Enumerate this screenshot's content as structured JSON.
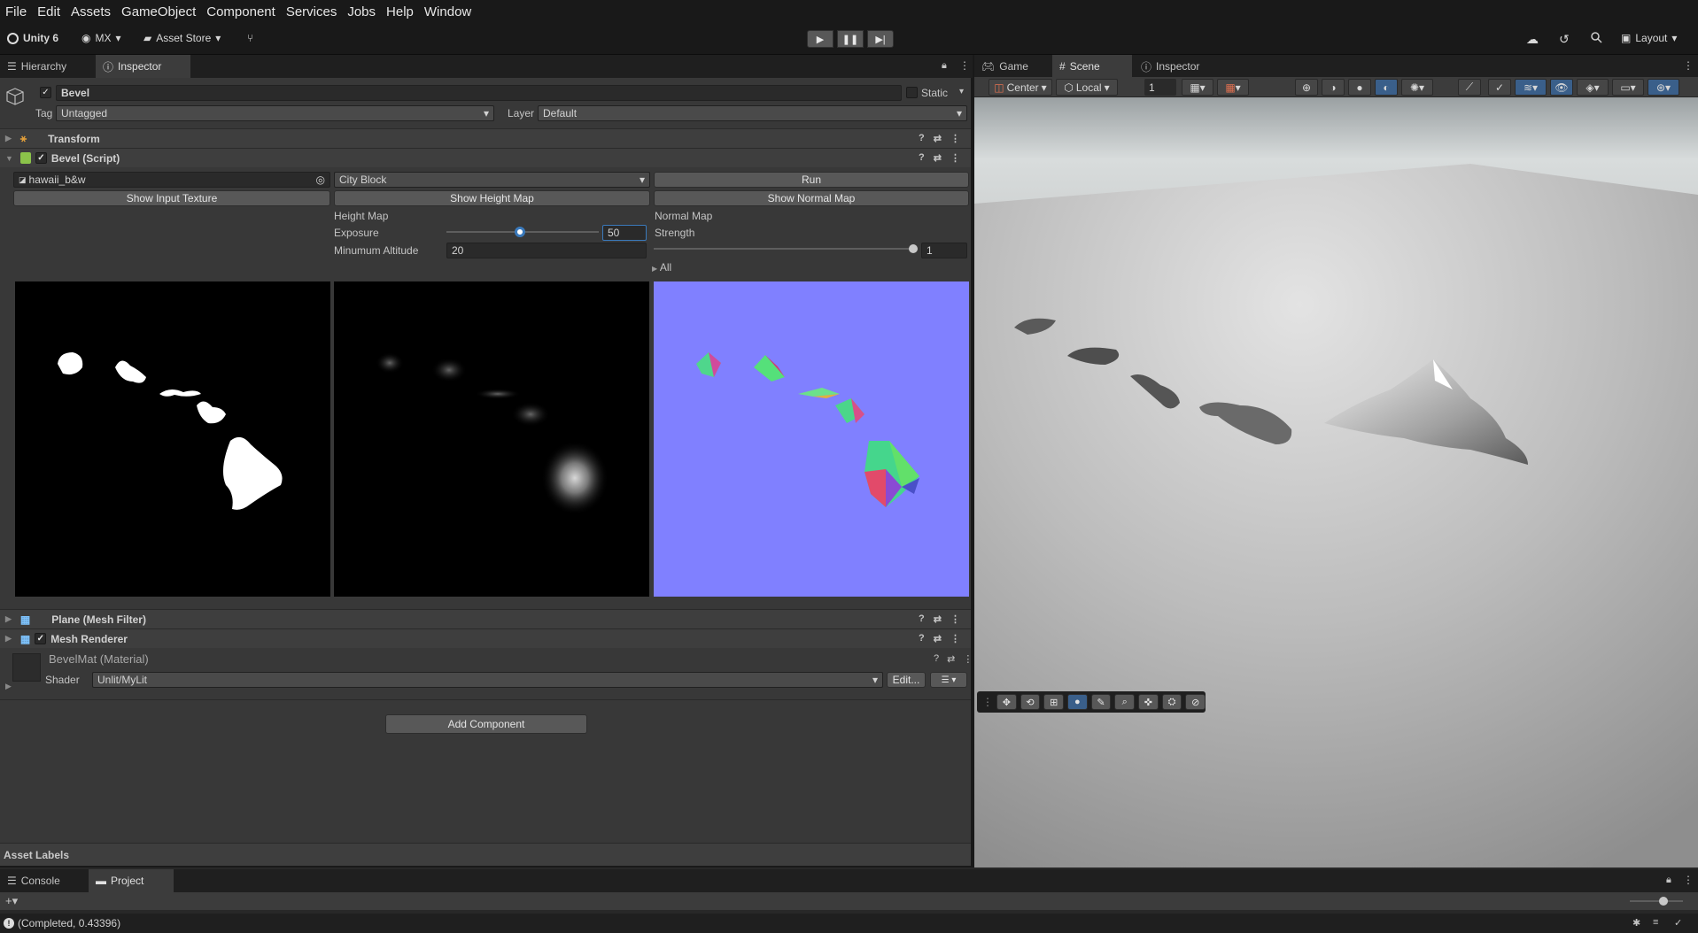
{
  "menubar": [
    "File",
    "Edit",
    "Assets",
    "GameObject",
    "Component",
    "Services",
    "Jobs",
    "Help",
    "Window"
  ],
  "toolbar": {
    "unity_label": "Unity 6",
    "account_label": "MX",
    "asset_store_label": "Asset Store",
    "layout_label": "Layout"
  },
  "left_tabs": {
    "hierarchy": "Hierarchy",
    "inspector": "Inspector"
  },
  "right_tabs": {
    "game": "Game",
    "scene": "Scene",
    "inspector": "Inspector"
  },
  "object": {
    "name": "Bevel",
    "static_label": "Static",
    "tag_label": "Tag",
    "tag_value": "Untagged",
    "layer_label": "Layer",
    "layer_value": "Default"
  },
  "components": {
    "transform": "Transform",
    "bevel_script": "Bevel (Script)",
    "mesh_filter": "Plane (Mesh Filter)",
    "mesh_renderer": "Mesh Renderer"
  },
  "bevel": {
    "texture_field": "hawaii_b&w",
    "mode_value": "City Block",
    "run_label": "Run",
    "show_input_label": "Show Input Texture",
    "show_height_label": "Show Height Map",
    "show_normal_label": "Show Normal Map",
    "height_map_label": "Height Map",
    "exposure_label": "Exposure",
    "exposure_value": "50",
    "exposure_fraction": 0.48,
    "min_alt_label": "Minumum Altitude",
    "min_alt_value": "20",
    "normal_map_label": "Normal Map",
    "strength_label": "Strength",
    "strength_value": "1",
    "strength_fraction": 1.0,
    "all_label": "All"
  },
  "material": {
    "name": "BevelMat (Material)",
    "shader_label": "Shader",
    "shader_value": "Unlit/MyLit",
    "edit_label": "Edit..."
  },
  "add_component_label": "Add Component",
  "asset_labels": "Asset Labels",
  "scene_toolbar": {
    "pivot": "Center",
    "space": "Local",
    "snap_value": "1"
  },
  "bottom_tabs": {
    "console": "Console",
    "project": "Project"
  },
  "status_text": "(Completed, 0.43396)",
  "colors": {
    "accent": "#3a79bb",
    "normal_map_bg": "#8080ff",
    "panel": "#383838"
  }
}
